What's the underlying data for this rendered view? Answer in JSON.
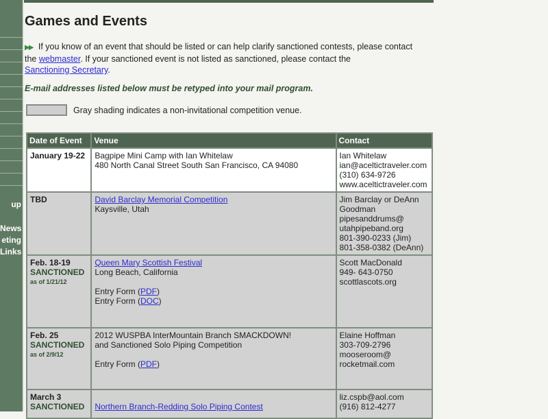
{
  "sidebar": {
    "items": [
      {
        "label": "up"
      },
      {
        "label": "News"
      },
      {
        "label": "eting"
      },
      {
        "label": "Links"
      }
    ]
  },
  "page": {
    "title": "Games and Events",
    "intro_part1": "If you know of an event that should be listed or can help clarify sanctioned contests, please contact the",
    "webmaster_link": "webmaster",
    "intro_part2": ". If your sanctioned event is not listed as sanctioned, please contact the",
    "secretary_link": "Sanctioning Secretary",
    "intro_end": ".",
    "email_warning": "E-mail addresses listed below must be retyped into your mail program.",
    "legend_text": "Gray shading indicates a non-invitational competition venue."
  },
  "table": {
    "headers": {
      "date": "Date of Event",
      "venue": "Venue",
      "contact": "Contact"
    },
    "rows": [
      {
        "date": "January 19-22",
        "venue_line1": "Bagpipe Mini Camp with Ian Whitelaw",
        "venue_line2": "480 North Canal Street South San Francisco, CA 94080",
        "contact": [
          "Ian Whitelaw",
          "ian@aceltictraveler.com",
          "(310) 634-9726",
          "www.aceltictraveler.com"
        ]
      },
      {
        "date": "TBD",
        "venue_link": "David Barclay Memorial Competition",
        "venue_line2": "Kaysville, Utah",
        "contact": [
          "Jim Barclay or DeAnn",
          "Goodman",
          "pipesanddrums@",
          "utahpipeband.org",
          "801-390-0233 (Jim)",
          "801-358-0382 (DeAnn)"
        ]
      },
      {
        "date": "Feb. 18-19",
        "status": "SANCTIONED",
        "as_of": "as of 1/21/12",
        "venue_link": "Queen Mary Scottish Festival",
        "venue_line2": "Long Beach, California",
        "entry_label": "Entry Form (",
        "entry_pdf": "PDF",
        "entry_close": ")",
        "entry2_label": "Entry Form (",
        "entry2_doc": "DOC",
        "entry2_close": ")",
        "contact": [
          "Scott MacDonald",
          "949- 643-0750",
          "scottlascots.org"
        ]
      },
      {
        "date": "Feb. 25",
        "status": "SANCTIONED",
        "as_of": "as of 2/9/12",
        "venue_line1": "2012 WUSPBA InterMountain Branch SMACKDOWN!",
        "venue_line2": "and Sanctioned Solo Piping Competition",
        "entry_label": "Entry Form (",
        "entry_pdf": "PDF",
        "entry_close": ")",
        "contact": [
          "Elaine Hoffman",
          "303-709-2796",
          "mooseroom@",
          "rocketmail.com"
        ]
      },
      {
        "date": "March 3",
        "status": "SANCTIONED",
        "venue_link": "Northern Branch-Redding Solo Piping Contest",
        "contact": [
          "liz.cspb@aol.com",
          "(916) 812-4277"
        ]
      }
    ]
  }
}
